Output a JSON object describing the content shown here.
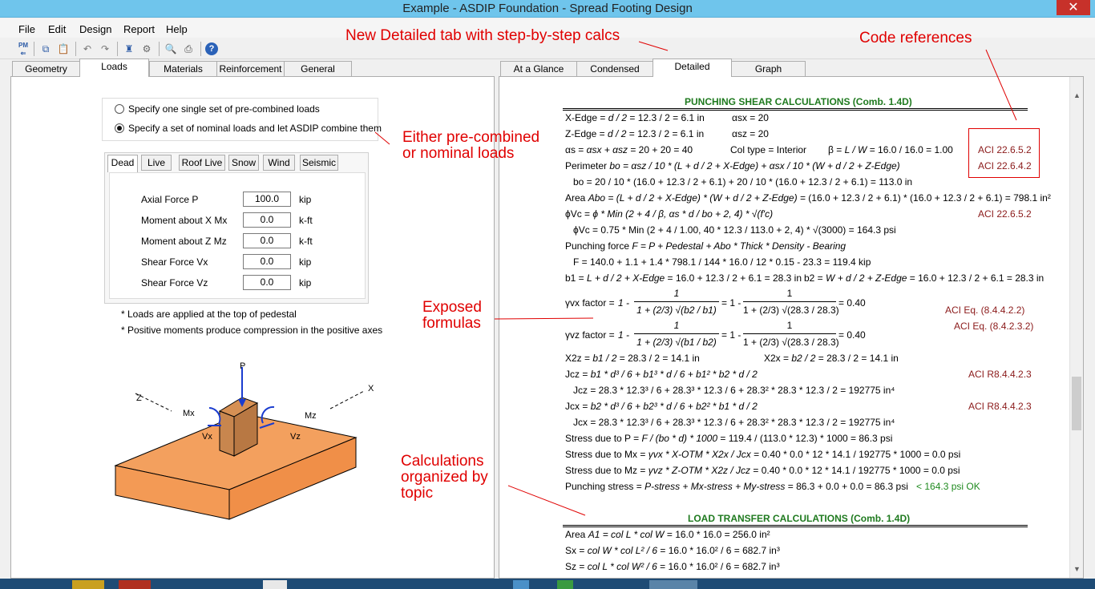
{
  "window": {
    "title": "Example - ASDIP Foundation - Spread Footing Design",
    "close_glyph": "✕"
  },
  "menu": [
    "File",
    "Edit",
    "Design",
    "Report",
    "Help"
  ],
  "toolbar_icons": [
    "pm-open-icon",
    "copy-icon",
    "paste-icon",
    "undo-icon",
    "redo-icon",
    "design-icon",
    "settings-icon",
    "preview-icon",
    "print-icon",
    "help-icon"
  ],
  "left_tabs": [
    "Geometry",
    "Loads",
    "Materials",
    "Reinforcement",
    "General"
  ],
  "right_tabs": [
    "At a Glance",
    "Condensed",
    "Detailed",
    "Graph"
  ],
  "load_options": {
    "opt1": "Specify one single set of pre-combined loads",
    "opt2": "Specify a set of nominal loads and let ASDIP combine them",
    "selected": 2
  },
  "load_tabs": [
    "Dead",
    "Live",
    "Roof Live",
    "Snow",
    "Wind",
    "Seismic"
  ],
  "loads": [
    {
      "label": "Axial Force  P",
      "value": "100.0",
      "unit": "kip"
    },
    {
      "label": "Moment about X  Mx",
      "value": "0.0",
      "unit": "k-ft"
    },
    {
      "label": "Moment about Z  Mz",
      "value": "0.0",
      "unit": "k-ft"
    },
    {
      "label": "Shear Force  Vx",
      "value": "0.0",
      "unit": "kip"
    },
    {
      "label": "Shear Force  Vz",
      "value": "0.0",
      "unit": "kip"
    }
  ],
  "notes": [
    "* Loads are applied at the top of pedestal",
    "* Positive moments produce compression in the positive axes"
  ],
  "diagram": {
    "P": "P",
    "Mx": "Mx",
    "Mz": "Mz",
    "Vx": "Vx",
    "Vz": "Vz",
    "Z": "Z",
    "X": "X",
    "footing_color": "#f3a05e",
    "pedestal_color": "#c8864e"
  },
  "calc": {
    "h1": "PUNCHING SHEAR CALCULATIONS (Comb. 1.4D)",
    "xedge_a": "X-Edge =",
    "xedge_b": "d / 2",
    "xedge_c": "=  12.3 / 2 = 6.1  in",
    "xedge_d": "αsx = 20",
    "zedge_a": "Z-Edge =",
    "zedge_b": "d / 2",
    "zedge_c": "=  12.3 / 2 = 6.1  in",
    "zedge_d": "αsz = 20",
    "as_a": "αs = ",
    "as_b": "αsx + αsz",
    "as_c": " = 20 + 20 = 40",
    "coltype": "Col type = Interior",
    "beta_a": "β = ",
    "beta_b": "L / W",
    "beta_c": " =  16.0 / 16.0 = 1.00",
    "ref1": "ACI 22.6.5.2",
    "per_a": "Perimeter  ",
    "per_b": "bo = αsz / 10 * (L + d / 2 + X-Edge) + αsx / 10 * (W + d / 2 + Z-Edge)",
    "ref2": "ACI 22.6.4.2",
    "bo": "bo = 20 / 10 * (16.0 + 12.3 / 2 + 6.1) + 20 / 10 * (16.0 + 12.3 / 2 + 6.1) = 113.0  in",
    "area_a": "Area  ",
    "area_b": "Abo = (L + d / 2 + X-Edge) * (W + d / 2 + Z-Edge) =",
    "area_c": "  (16.0 + 12.3 / 2 + 6.1) * (16.0 + 12.3 / 2 + 6.1) = 798.1  in²",
    "phivc_a": "ϕVc = ",
    "phivc_b": " ϕ * Min (2 + 4 / β,  αs * d / bo + 2,  4) * √(f'c)",
    "ref3": "ACI 22.6.5.2",
    "phivc2": "ϕVc = 0.75 * Min (2 + 4 / 1.00,  40 * 12.3 / 113.0 + 2,  4) * √(3000) = 164.3  psi",
    "pf_a": "Punching force    ",
    "pf_b": "F = P + Pedestal + Abo * Thick * Density - Bearing",
    "pf2": "F = 140.0 + 1.1 + 1.4 * 798.1 / 144 * 16.0 / 12 * 0.15 - 23.3 = 119.4  kip",
    "b1_a": "b1 = ",
    "b1_b": "L + d / 2 + X-Edge",
    "b1_c": " = 16.0 + 12.3 / 2 + 6.1 = 28.3  in",
    "b2_a": "b2 = ",
    "b2_b": "W + d / 2 + Z-Edge",
    "b2_c": " = 16.0 + 12.3 / 2 + 6.1 = 28.3  in",
    "gvx_a": "γvx factor =  ",
    "gvx_b": "1 -",
    "one": "1",
    "gvx_den": "1 + (2/3) √(b2 / b1)",
    "gvx_c": "= 1 -",
    "gvx_den2": "1 + (2/3) √(28.3 / 28.3)",
    "gvx_d": "= 0.40",
    "ref4": "ACI Eq. (8.4.4.2.2)",
    "gvz_a": "γvz factor =  ",
    "gvz_b": "1 -",
    "gvz_den": "1 + (2/3) √(b1 / b2)",
    "gvz_c": "= 1 -",
    "gvz_den2": "1 + (2/3) √(28.3 / 28.3)",
    "gvz_d": "= 0.40",
    "ref5": "ACI Eq. (8.4.2.3.2)",
    "x2z_a": "X2z = ",
    "x2z_b": " b1 / 2",
    "x2z_c": " =  28.3 / 2 = 14.1  in",
    "x2x_a": "X2x = ",
    "x2x_b": " b2 / 2",
    "x2x_c": " =  28.3 / 2 = 14.1  in",
    "jcz_a": "Jcz = ",
    "jcz_b": "b1 * d³ / 6 + b1³ * d / 6 + b1² * b2 * d / 2",
    "ref6": "ACI R8.4.4.2.3",
    "jcz2": "Jcz = 28.3 * 12.3³ / 6 + 28.3³ * 12.3 / 6 + 28.3² * 28.3 * 12.3 / 2 = 192775 in⁴",
    "jcx_a": "Jcx = ",
    "jcx_b": "b2 * d³ / 6 + b2³ * d / 6 + b2² * b1 * d / 2",
    "ref7": "ACI R8.4.4.2.3",
    "jcx2": "Jcx = 28.3 * 12.3³ / 6 + 28.3³ * 12.3 / 6 + 28.3² * 28.3 * 12.3 / 2 = 192775 in⁴",
    "sp_a": "Stress due to P = ",
    "sp_b": " F / (bo * d) * 1000",
    "sp_c": " =  119.4 / (113.0 * 12.3) * 1000 = 86.3  psi",
    "smx_a": "Stress due to Mx = ",
    "smx_b": " γvx * X-OTM * X2x / Jcx",
    "smx_c": " =  0.40 * 0.0 * 12 * 14.1 / 192775 * 1000 = 0.0  psi",
    "smz_a": "Stress due to Mz = ",
    "smz_b": " γvz * Z-OTM * X2z / Jcz",
    "smz_c": " =  0.40 * 0.0 * 12 * 14.1 / 192775 * 1000 = 0.0  psi",
    "ps_a": "Punching stress = ",
    "ps_b": " P-stress + Mx-stress + My-stress",
    "ps_c": " =  86.3 + 0.0 + 0.0 = 86.3  psi",
    "ps_ok": "<  164.3  psi   OK",
    "h2": "LOAD TRANSFER CALCULATIONS (Comb. 1.4D)",
    "a1_a": "Area  ",
    "a1_b": "A1 = col L * col W",
    "a1_c": " =  16.0 * 16.0 = 256.0  in²",
    "sx_a": "Sx = ",
    "sx_b": " col W * col L² / 6",
    "sx_c": " = 16.0 * 16.0² / 6 = 682.7  in³",
    "sz_a": "Sz = ",
    "sz_b": " col L * col W² / 6",
    "sz_c": " = 16.0 * 16.0² / 6 = 682.7  in³"
  },
  "annotations": {
    "a1": "New Detailed tab with step-by-step calcs",
    "a2": "Code references",
    "a3a": "Either pre-combined",
    "a3b": "or nominal loads",
    "a4a": "Exposed",
    "a4b": "formulas",
    "a5a": "Calculations",
    "a5b": "organized by",
    "a5c": "topic"
  }
}
